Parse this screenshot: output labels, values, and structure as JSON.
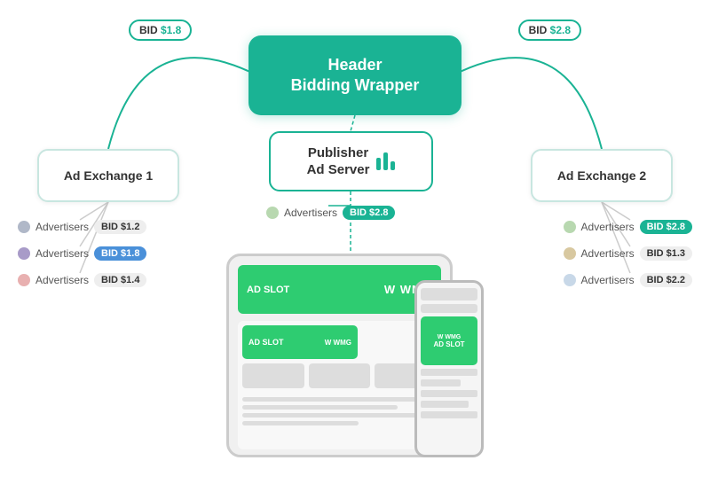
{
  "hbw": {
    "label": "Header\nBidding Wrapper"
  },
  "pas": {
    "label": "Publisher\nAd Server"
  },
  "exchanges": {
    "left": {
      "label": "Ad Exchange 1"
    },
    "right": {
      "label": "Ad Exchange 2"
    }
  },
  "bids": {
    "arc_left": {
      "amount": "$1.8"
    },
    "arc_right": {
      "amount": "$2.8"
    },
    "adv_left1": {
      "label": "Advertisers",
      "amount": "BID $1.2",
      "type": "normal"
    },
    "adv_left2": {
      "label": "Advertisers",
      "amount": "BID $1.8",
      "type": "blue"
    },
    "adv_left3": {
      "label": "Advertisers",
      "amount": "BID $1.4",
      "type": "normal"
    },
    "adv_right1": {
      "label": "Advertisers",
      "amount": "BID $2.8",
      "type": "green"
    },
    "adv_right2": {
      "label": "Advertisers",
      "amount": "BID $1.3",
      "type": "normal"
    },
    "adv_right3": {
      "label": "Advertisers",
      "amount": "BID $2.2",
      "type": "normal"
    },
    "adv_center": {
      "label": "Advertisers",
      "amount": "BID $2.8",
      "type": "green"
    }
  },
  "device": {
    "tablet_ad_slot": "AD SLOT",
    "wmg": "W WMG",
    "inner_ad_slot": "AD SLOT",
    "phone_ad": "W WMG\nAD SLOT"
  }
}
